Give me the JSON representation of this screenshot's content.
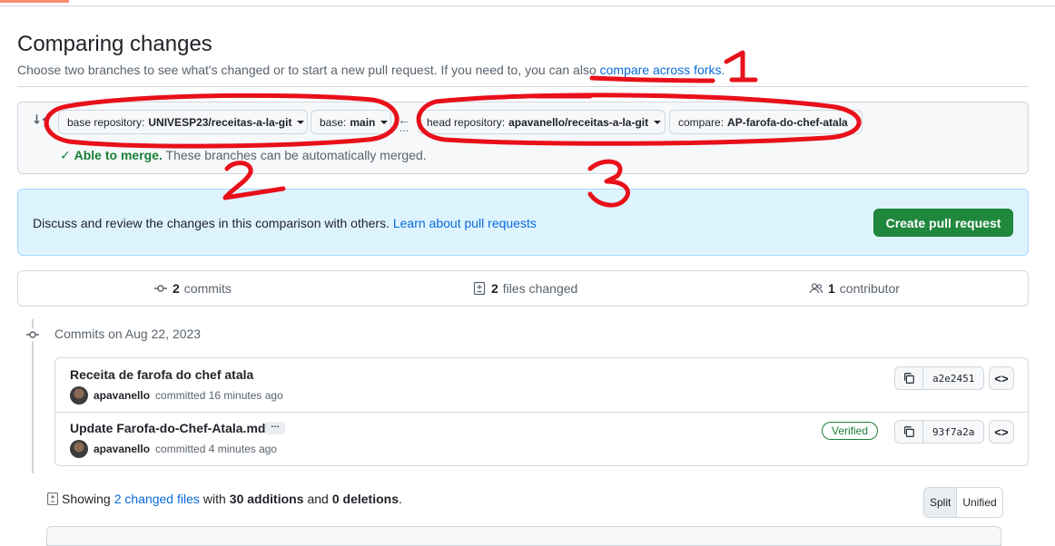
{
  "header": {
    "title": "Comparing changes",
    "subtitle_prefix": "Choose two branches to see what's changed or to start a new pull request. If you need to, you can also ",
    "subtitle_link": "compare across forks",
    "subtitle_suffix": "."
  },
  "range": {
    "base_repo_label": "base repository:",
    "base_repo_value": "UNIVESP23/receitas-a-la-git",
    "base_label": "base:",
    "base_value": "main",
    "dots": "...",
    "head_repo_label": "head repository:",
    "head_repo_value": "apavanello/receitas-a-la-git",
    "compare_label": "compare:",
    "compare_value": "AP-farofa-do-chef-atala",
    "merge_status": "Able to merge.",
    "merge_detail": " These branches can be automatically merged."
  },
  "info": {
    "text": "Discuss and review the changes in this comparison with others. ",
    "link": "Learn about pull requests",
    "create_button": "Create pull request"
  },
  "summary": {
    "commits_count": "2",
    "commits_label": "commits",
    "files_count": "2",
    "files_label": "files changed",
    "contributors_count": "1",
    "contributors_label": "contributor"
  },
  "commits": {
    "date_label": "Commits on Aug 22, 2023",
    "items": [
      {
        "title": "Receita de farofa do chef atala",
        "author": "apavanello",
        "time": "committed 16 minutes ago",
        "sha": "a2e2451"
      },
      {
        "title": "Update Farofa-do-Chef-Atala.md",
        "ellipsis": "…",
        "author": "apavanello",
        "time": "committed 4 minutes ago",
        "sha": "93f7a2a",
        "badge": "Verified"
      }
    ]
  },
  "files": {
    "showing": "Showing",
    "changed_link": "2 changed files",
    "with": "with",
    "additions": "30 additions",
    "and": "and",
    "deletions": "0 deletions",
    "period": ".",
    "split_label": "Split",
    "unified_label": "Unified"
  },
  "annotations": {
    "marks": [
      "1",
      "2",
      "3"
    ],
    "color": "#e8101a"
  },
  "colors": {
    "primary_button": "#1f883d",
    "link": "#0969da",
    "info_bg": "#ddf4ff",
    "success": "#1a7f37"
  }
}
